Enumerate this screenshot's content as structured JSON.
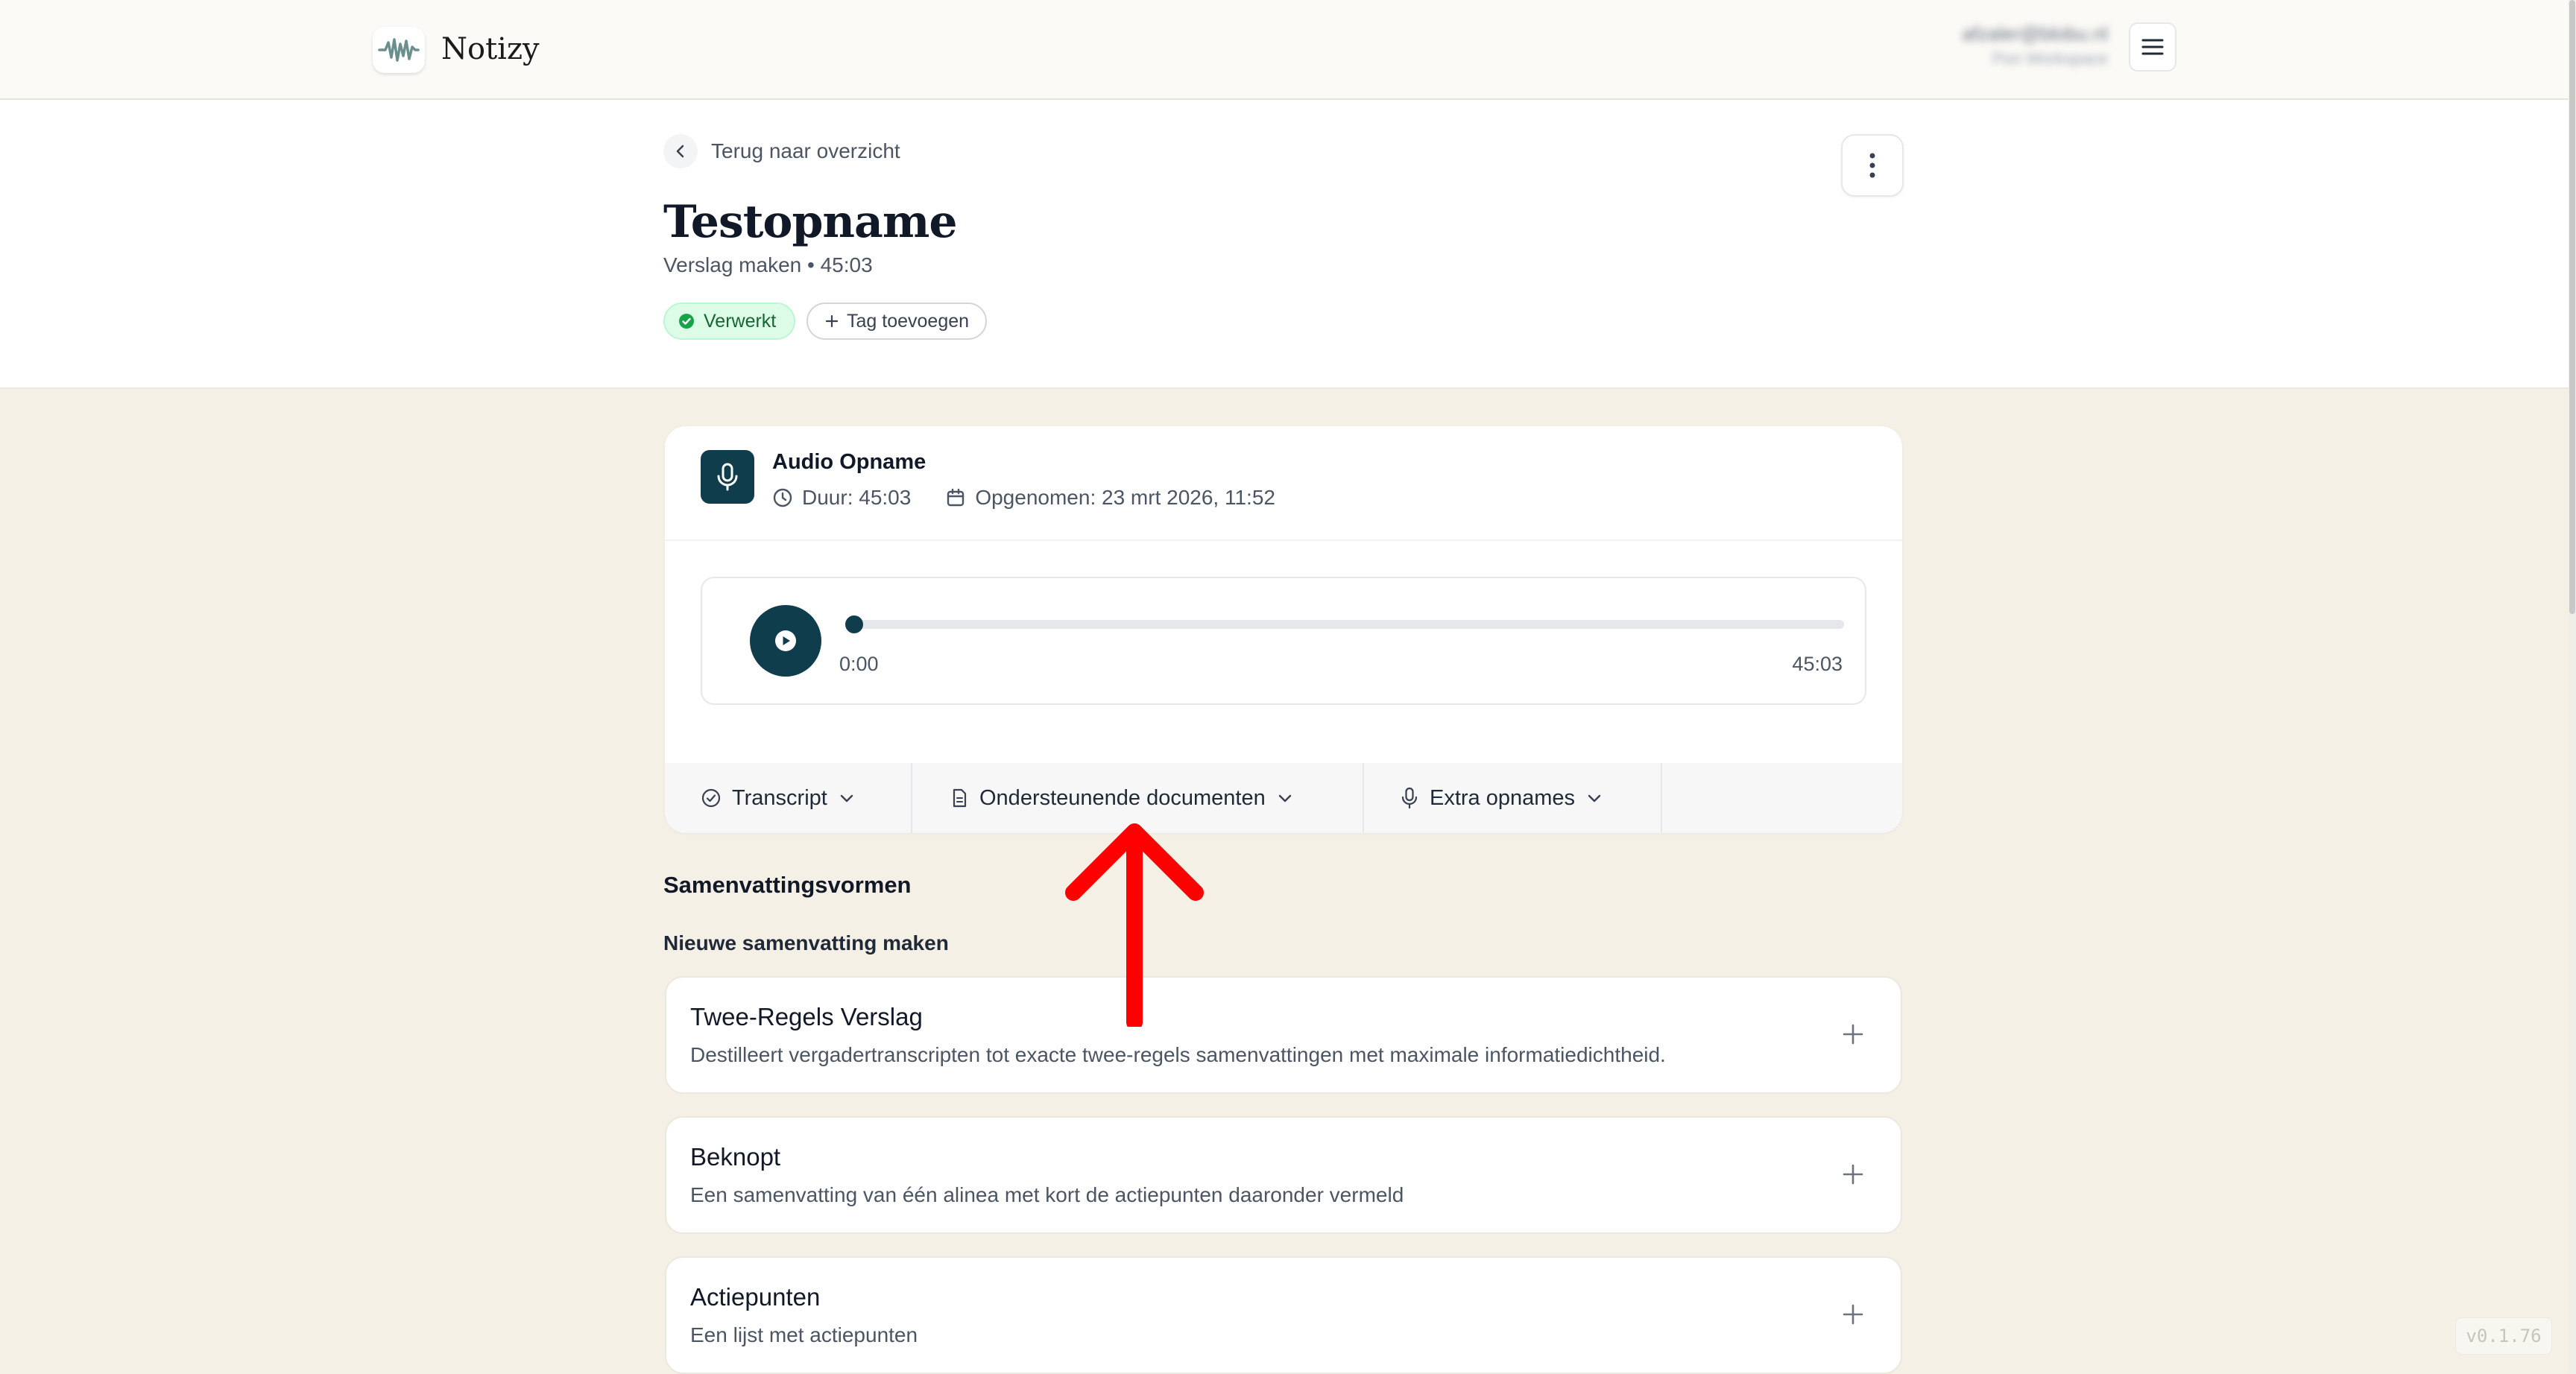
{
  "brand": {
    "name": "Notizy"
  },
  "user": {
    "email": "afzaler@blobu.nl",
    "workspace": "Pon Workspace"
  },
  "nav": {
    "back_label": "Terug naar overzicht"
  },
  "recording": {
    "title": "Testopname",
    "subtitle": "Verslag maken • 45:03",
    "status_tag": "Verwerkt",
    "add_tag_label": "Tag toevoegen"
  },
  "audio": {
    "title": "Audio Opname",
    "duration": "Duur: 45:03",
    "recorded": "Opgenomen: 23 mrt 2026, 11:52",
    "current_time": "0:00",
    "total_time": "45:03",
    "progress": 0
  },
  "tabs": [
    {
      "label": "Transcript",
      "icon": "check-circle-icon"
    },
    {
      "label": "Ondersteunende documenten",
      "icon": "document-icon"
    },
    {
      "label": "Extra opnames",
      "icon": "microphone-icon"
    }
  ],
  "summaries": {
    "heading": "Samenvattingsvormen",
    "subheading": "Nieuwe samenvatting maken",
    "items": [
      {
        "title": "Twee-Regels Verslag",
        "description": "Destilleert vergadertranscripten tot exacte twee-regels samenvattingen met maximale informatiedichtheid."
      },
      {
        "title": "Beknopt",
        "description": "Een samenvatting van één alinea met kort de actiepunten daaronder vermeld"
      },
      {
        "title": "Actiepunten",
        "description": "Een lijst met actiepunten"
      }
    ]
  },
  "version": "v0.1.76",
  "colors": {
    "accent": "#0f3d4c",
    "success_bg": "#dcfce7",
    "success_text": "#166534",
    "annotation": "#ff0000"
  }
}
